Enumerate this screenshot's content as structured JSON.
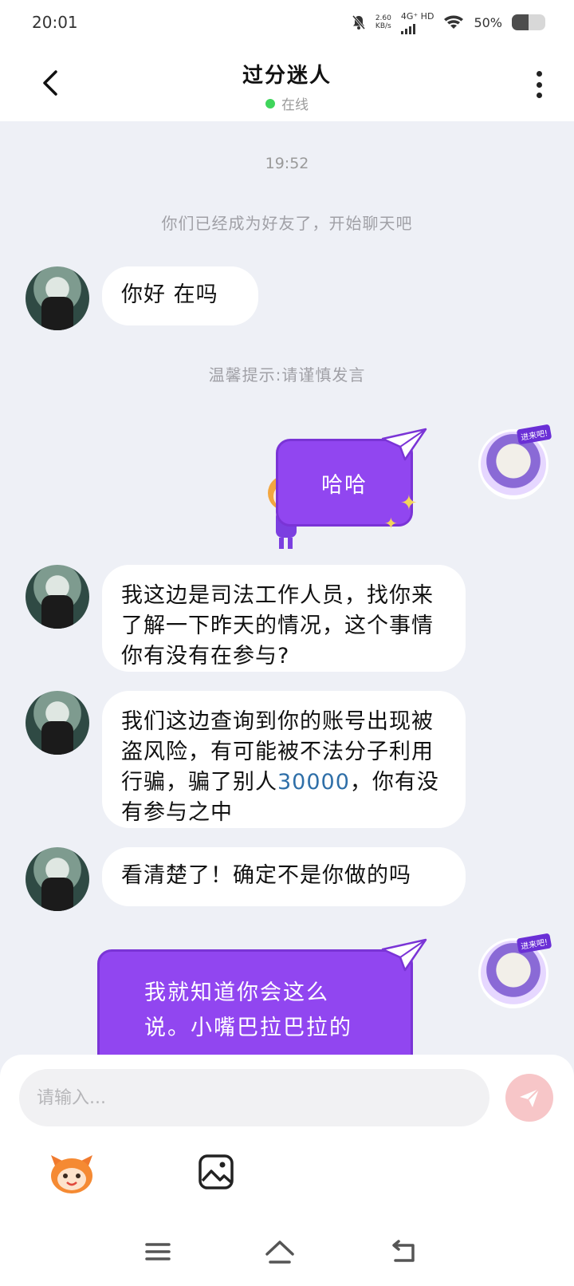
{
  "status_bar": {
    "time": "20:01",
    "speed_value": "2.60",
    "speed_unit": "KB/s",
    "network": "4G⁺ HD",
    "battery_pct": "50%",
    "battery_level": 0.5,
    "icons": [
      "mute-bell-icon",
      "signal-icon",
      "wifi-icon",
      "battery-icon"
    ]
  },
  "header": {
    "title": "过分迷人",
    "presence": "在线",
    "presence_color": "#3fd55b"
  },
  "chat": {
    "time_label": "19:52",
    "system_friend": "你们已经成为好友了，开始聊天吧",
    "system_tip": "温馨提示:请谨慎发言",
    "messages": [
      {
        "sender": "other",
        "text": "你好  在吗"
      },
      {
        "sender": "me",
        "text": "哈哈"
      },
      {
        "sender": "other",
        "text": "我这边是司法工作人员，找你来了解一下昨天的情况，这个事情你有没有在参与?"
      },
      {
        "sender": "other",
        "text_before": "我们这边查询到你的账号出现被盗风险，有可能被不法分子利用行骗，骗了别人",
        "number": "30000",
        "text_after": "，你有没有参与之中"
      },
      {
        "sender": "other",
        "text": "看清楚了！确定不是你做的吗"
      },
      {
        "sender": "me",
        "text": "我就知道你会这么说。小嘴巴拉巴拉的"
      }
    ],
    "me_avatar_tag": "进来吧!"
  },
  "composer": {
    "placeholder": "请输入...",
    "send_color": "#f7c6c8"
  },
  "colors": {
    "me_bubble": "#9146f0",
    "background": "#eef0f6",
    "number_highlight": "#2f6fa8"
  }
}
